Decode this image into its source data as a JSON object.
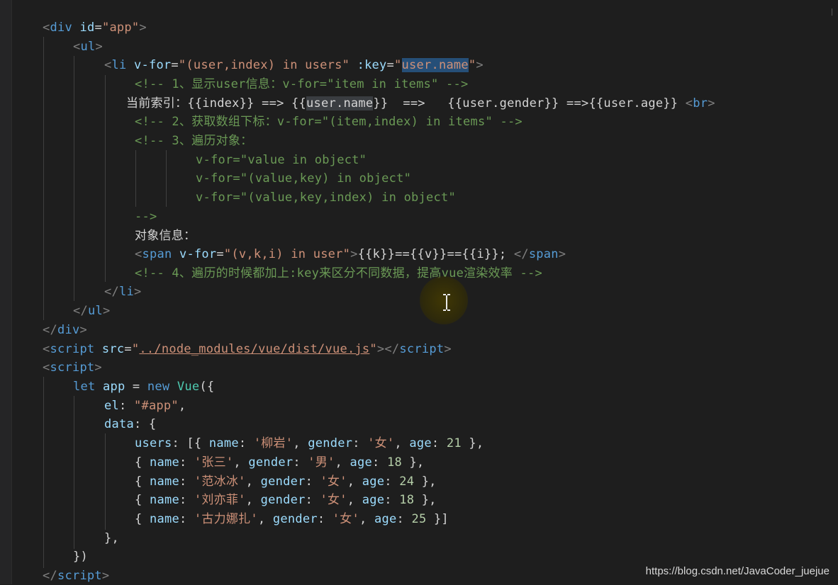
{
  "colors": {
    "background": "#1e1e1e",
    "tag": "#569cd6",
    "attribute": "#9cdcfe",
    "string": "#ce9178",
    "comment": "#6a9955",
    "selection": "#264f78"
  },
  "watermark": "https://blog.csdn.net/JavaCoder_juejue",
  "lines": [
    [
      [
        "br",
        "<"
      ],
      [
        "tag",
        "div"
      ],
      [
        "txt",
        " "
      ],
      [
        "attr",
        "id"
      ],
      [
        "txt",
        "="
      ],
      [
        "str",
        "\"app\""
      ],
      [
        "br",
        ">"
      ]
    ],
    [
      [
        "br",
        "<"
      ],
      [
        "tag",
        "ul"
      ],
      [
        "br",
        ">"
      ]
    ],
    [
      [
        "br",
        "<"
      ],
      [
        "tag",
        "li"
      ],
      [
        "txt",
        " "
      ],
      [
        "attr",
        "v-for"
      ],
      [
        "txt",
        "="
      ],
      [
        "str",
        "\"(user,index) in users\""
      ],
      [
        "txt",
        " "
      ],
      [
        "attr",
        ":key"
      ],
      [
        "txt",
        "="
      ],
      [
        "str",
        "\""
      ],
      [
        "sel",
        "user.name"
      ],
      [
        "str",
        "\""
      ],
      [
        "br",
        ">"
      ]
    ],
    [
      [
        "com",
        "<!-- 1、显示user信息：v-for=\"item in items\" -->"
      ]
    ],
    [
      [
        "txt",
        "当前索引：{{index}} ==> {{"
      ],
      [
        "hl",
        "user.name"
      ],
      [
        "txt",
        "}}  ==>   {{user.gender}} ==>{{user.age}} "
      ],
      [
        "br",
        "<"
      ],
      [
        "tag",
        "br"
      ],
      [
        "br",
        ">"
      ]
    ],
    [
      [
        "com",
        "<!-- 2、获取数组下标：v-for=\"(item,index) in items\" -->"
      ]
    ],
    [
      [
        "com",
        "<!-- 3、遍历对象："
      ]
    ],
    [
      [
        "com",
        "v-for=\"value in object\""
      ]
    ],
    [
      [
        "com",
        "v-for=\"(value,key) in object\""
      ]
    ],
    [
      [
        "com",
        "v-for=\"(value,key,index) in object\""
      ]
    ],
    [
      [
        "com",
        "-->"
      ]
    ],
    [
      [
        "txt",
        "对象信息："
      ]
    ],
    [
      [
        "br",
        "<"
      ],
      [
        "tag",
        "span"
      ],
      [
        "txt",
        " "
      ],
      [
        "attr",
        "v-for"
      ],
      [
        "txt",
        "="
      ],
      [
        "str",
        "\"(v,k,i) in user\""
      ],
      [
        "br",
        ">"
      ],
      [
        "txt",
        "{{k}}=={{v}}=={{i}}; "
      ],
      [
        "br",
        "</"
      ],
      [
        "tag",
        "span"
      ],
      [
        "br",
        ">"
      ]
    ],
    [
      [
        "com",
        "<!-- 4、遍历的时候都加上:key来区分不同数据，提高vue渲染效率 -->"
      ]
    ],
    [
      [
        "br",
        "</"
      ],
      [
        "tag",
        "li"
      ],
      [
        "br",
        ">"
      ]
    ],
    [
      [
        "br",
        "</"
      ],
      [
        "tag",
        "ul"
      ],
      [
        "br",
        ">"
      ]
    ],
    [
      [
        "br",
        "</"
      ],
      [
        "tag",
        "div"
      ],
      [
        "br",
        ">"
      ]
    ],
    [
      [
        "br",
        "<"
      ],
      [
        "tag",
        "script"
      ],
      [
        "txt",
        " "
      ],
      [
        "attr",
        "src"
      ],
      [
        "txt",
        "="
      ],
      [
        "str",
        "\""
      ],
      [
        "link",
        "../node_modules/vue/dist/vue.js"
      ],
      [
        "str",
        "\""
      ],
      [
        "br",
        "></"
      ],
      [
        "tag",
        "script"
      ],
      [
        "br",
        ">"
      ]
    ],
    [
      [
        "br",
        "<"
      ],
      [
        "tag",
        "script"
      ],
      [
        "br",
        ">"
      ]
    ],
    [
      [
        "kw",
        "let"
      ],
      [
        "txt",
        " "
      ],
      [
        "var",
        "app"
      ],
      [
        "txt",
        " = "
      ],
      [
        "kw",
        "new"
      ],
      [
        "txt",
        " "
      ],
      [
        "cls",
        "Vue"
      ],
      [
        "txt",
        "({"
      ]
    ],
    [
      [
        "var",
        "el"
      ],
      [
        "txt",
        ": "
      ],
      [
        "str",
        "\"#app\""
      ],
      [
        "txt",
        ","
      ]
    ],
    [
      [
        "var",
        "data"
      ],
      [
        "txt",
        ": {"
      ]
    ],
    [
      [
        "var",
        "users"
      ],
      [
        "txt",
        ": [{ "
      ],
      [
        "var",
        "name"
      ],
      [
        "txt",
        ": "
      ],
      [
        "str",
        "'柳岩'"
      ],
      [
        "txt",
        ", "
      ],
      [
        "var",
        "gender"
      ],
      [
        "txt",
        ": "
      ],
      [
        "str",
        "'女'"
      ],
      [
        "txt",
        ", "
      ],
      [
        "var",
        "age"
      ],
      [
        "txt",
        ": "
      ],
      [
        "num",
        "21"
      ],
      [
        "txt",
        " },"
      ]
    ],
    [
      [
        "txt",
        "{ "
      ],
      [
        "var",
        "name"
      ],
      [
        "txt",
        ": "
      ],
      [
        "str",
        "'张三'"
      ],
      [
        "txt",
        ", "
      ],
      [
        "var",
        "gender"
      ],
      [
        "txt",
        ": "
      ],
      [
        "str",
        "'男'"
      ],
      [
        "txt",
        ", "
      ],
      [
        "var",
        "age"
      ],
      [
        "txt",
        ": "
      ],
      [
        "num",
        "18"
      ],
      [
        "txt",
        " },"
      ]
    ],
    [
      [
        "txt",
        "{ "
      ],
      [
        "var",
        "name"
      ],
      [
        "txt",
        ": "
      ],
      [
        "str",
        "'范冰冰'"
      ],
      [
        "txt",
        ", "
      ],
      [
        "var",
        "gender"
      ],
      [
        "txt",
        ": "
      ],
      [
        "str",
        "'女'"
      ],
      [
        "txt",
        ", "
      ],
      [
        "var",
        "age"
      ],
      [
        "txt",
        ": "
      ],
      [
        "num",
        "24"
      ],
      [
        "txt",
        " },"
      ]
    ],
    [
      [
        "txt",
        "{ "
      ],
      [
        "var",
        "name"
      ],
      [
        "txt",
        ": "
      ],
      [
        "str",
        "'刘亦菲'"
      ],
      [
        "txt",
        ", "
      ],
      [
        "var",
        "gender"
      ],
      [
        "txt",
        ": "
      ],
      [
        "str",
        "'女'"
      ],
      [
        "txt",
        ", "
      ],
      [
        "var",
        "age"
      ],
      [
        "txt",
        ": "
      ],
      [
        "num",
        "18"
      ],
      [
        "txt",
        " },"
      ]
    ],
    [
      [
        "txt",
        "{ "
      ],
      [
        "var",
        "name"
      ],
      [
        "txt",
        ": "
      ],
      [
        "str",
        "'古力娜扎'"
      ],
      [
        "txt",
        ", "
      ],
      [
        "var",
        "gender"
      ],
      [
        "txt",
        ": "
      ],
      [
        "str",
        "'女'"
      ],
      [
        "txt",
        ", "
      ],
      [
        "var",
        "age"
      ],
      [
        "txt",
        ": "
      ],
      [
        "num",
        "25"
      ],
      [
        "txt",
        " }]"
      ]
    ],
    [
      [
        "txt",
        "},"
      ]
    ],
    [
      [
        "txt",
        "})"
      ]
    ],
    [
      [
        "br",
        "</"
      ],
      [
        "tag",
        "script"
      ],
      [
        "br",
        ">"
      ]
    ]
  ]
}
